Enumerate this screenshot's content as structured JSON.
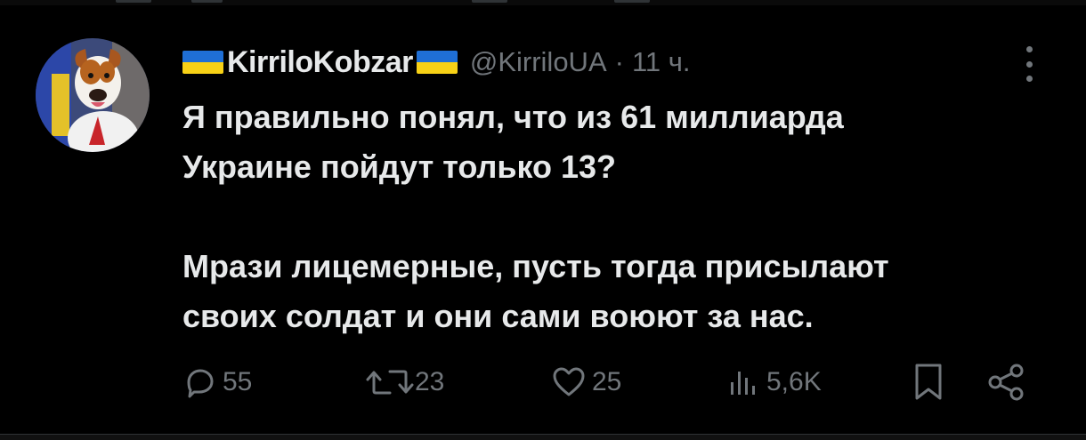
{
  "tweet": {
    "display_name": "KirriloKobzar",
    "handle": "@KirriloUA",
    "separator": "·",
    "time": "11 ч.",
    "text_paragraphs": [
      [
        "Я правильно понял, что из 61 миллиарда",
        "Украине пойдут только 13?"
      ],
      [
        "Мрази лицемерные, пусть тогда присылают",
        "своих солдат и они сами воюют за нас."
      ]
    ]
  },
  "actions": {
    "replies": "55",
    "reposts": "23",
    "likes": "25",
    "views": "5,6K"
  },
  "icons": {
    "reply": "reply-icon",
    "repost": "repost-icon",
    "like": "heart-icon",
    "views": "views-icon",
    "bookmark": "bookmark-icon",
    "share": "share-icon",
    "more": "more-icon",
    "flag": "ukraine-flag-icon"
  },
  "colors": {
    "background": "#000000",
    "text": "#e7e9ea",
    "muted": "#71767b",
    "flag_blue": "#1f6fd6",
    "flag_yellow": "#f7d116"
  }
}
